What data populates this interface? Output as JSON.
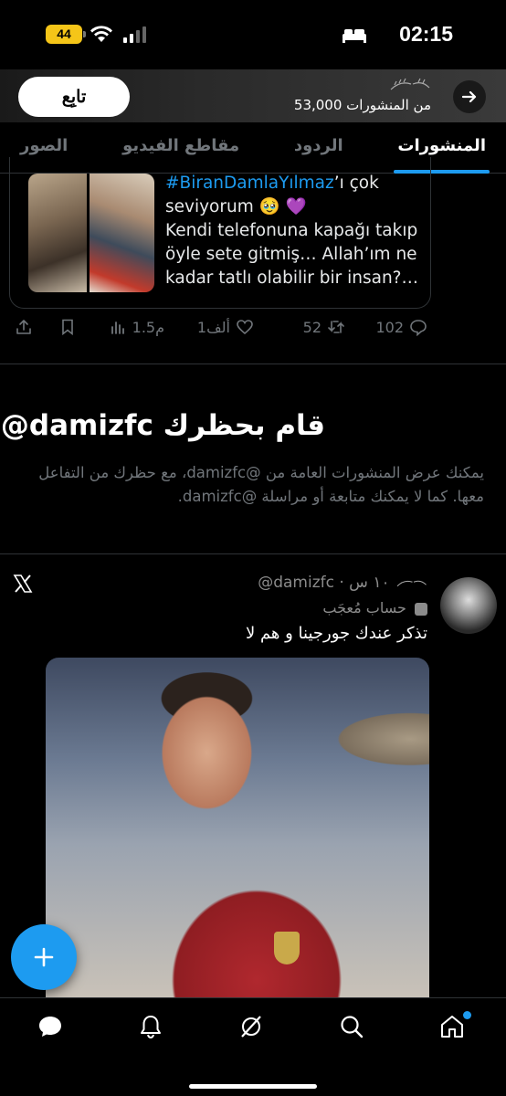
{
  "status_bar": {
    "time": "02:15",
    "battery": "44",
    "icons": [
      "signal-icon",
      "wifi-icon",
      "battery-icon",
      "bed-icon"
    ]
  },
  "header": {
    "follow_label": "تابِع",
    "post_count": "53,000 من المنشورات",
    "back_icon": "arrow-right-icon"
  },
  "tabs": [
    {
      "label": "المنشورات",
      "active": true
    },
    {
      "label": "الردود",
      "active": false
    },
    {
      "label": "مقاطع الفيديو",
      "active": false
    },
    {
      "label": "الصور",
      "active": false
    }
  ],
  "quoted_tweet": {
    "hashtag": "#BiranDamlaYılmaz",
    "text_after_hashtag": "’ı çok seviyorum 🥹 💜",
    "line2": "Kendi telefonuna kapağı takıp öyle sete gitmiş… Allah’ım ne kadar tatlı olabilir bir insan?…"
  },
  "actions": {
    "replies": "102",
    "reposts": "52",
    "likes": "1ألف",
    "views": "1.5م"
  },
  "blocked": {
    "title": "@damizfc قام بحظرك",
    "description": "يمكنك عرض المنشورات العامة من @damizfc، مع حظرك من التفاعل معها. كما لا يمكنك متابعة أو مراسلة @damizfc."
  },
  "embedded_tweet": {
    "handle_line": "@damizfc · ١٠ س",
    "account_type": "حساب مُعجَب",
    "text": "تذكر عندك جورجينا و هم لا"
  },
  "colors": {
    "accent": "#1d9bf0",
    "muted": "#71767b",
    "background": "#000000"
  }
}
